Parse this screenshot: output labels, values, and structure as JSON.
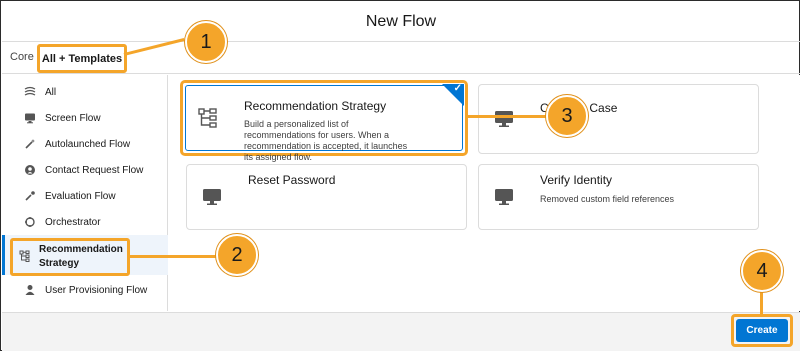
{
  "window": {
    "title": "New Flow"
  },
  "tabs": [
    {
      "label": "Core"
    },
    {
      "label": "All + Templates"
    }
  ],
  "sidebar": {
    "items": [
      {
        "label": "All",
        "icon": "flow-lines-icon"
      },
      {
        "label": "Screen Flow",
        "icon": "desktop-icon"
      },
      {
        "label": "Autolaunched Flow",
        "icon": "magic-wand-icon"
      },
      {
        "label": "Contact Request Flow",
        "icon": "contact-request-icon"
      },
      {
        "label": "Evaluation Flow",
        "icon": "evaluation-icon"
      },
      {
        "label": "Orchestrator",
        "icon": "orchestrator-icon"
      },
      {
        "label": "Recommendation Strategy",
        "icon": "hierarchy-icon"
      },
      {
        "label": "User Provisioning Flow",
        "icon": "user-icon"
      }
    ]
  },
  "cards": [
    {
      "title": "Recommendation Strategy",
      "description": "Build a personalized list of recommendations for users. When a recommendation is accepted, it launches its assigned flow.",
      "icon": "hierarchy-icon"
    },
    {
      "title": "Create a Case",
      "description": "",
      "icon": "desktop-icon"
    },
    {
      "title": "Reset Password",
      "description": "",
      "icon": "desktop-icon"
    },
    {
      "title": "Verify Identity",
      "description": "Removed custom field references",
      "icon": "desktop-icon"
    }
  ],
  "footer": {
    "create_label": "Create"
  },
  "callouts": [
    "1",
    "2",
    "3",
    "4"
  ],
  "colors": {
    "accent": "#f4a52a",
    "brand": "#0176d3"
  }
}
